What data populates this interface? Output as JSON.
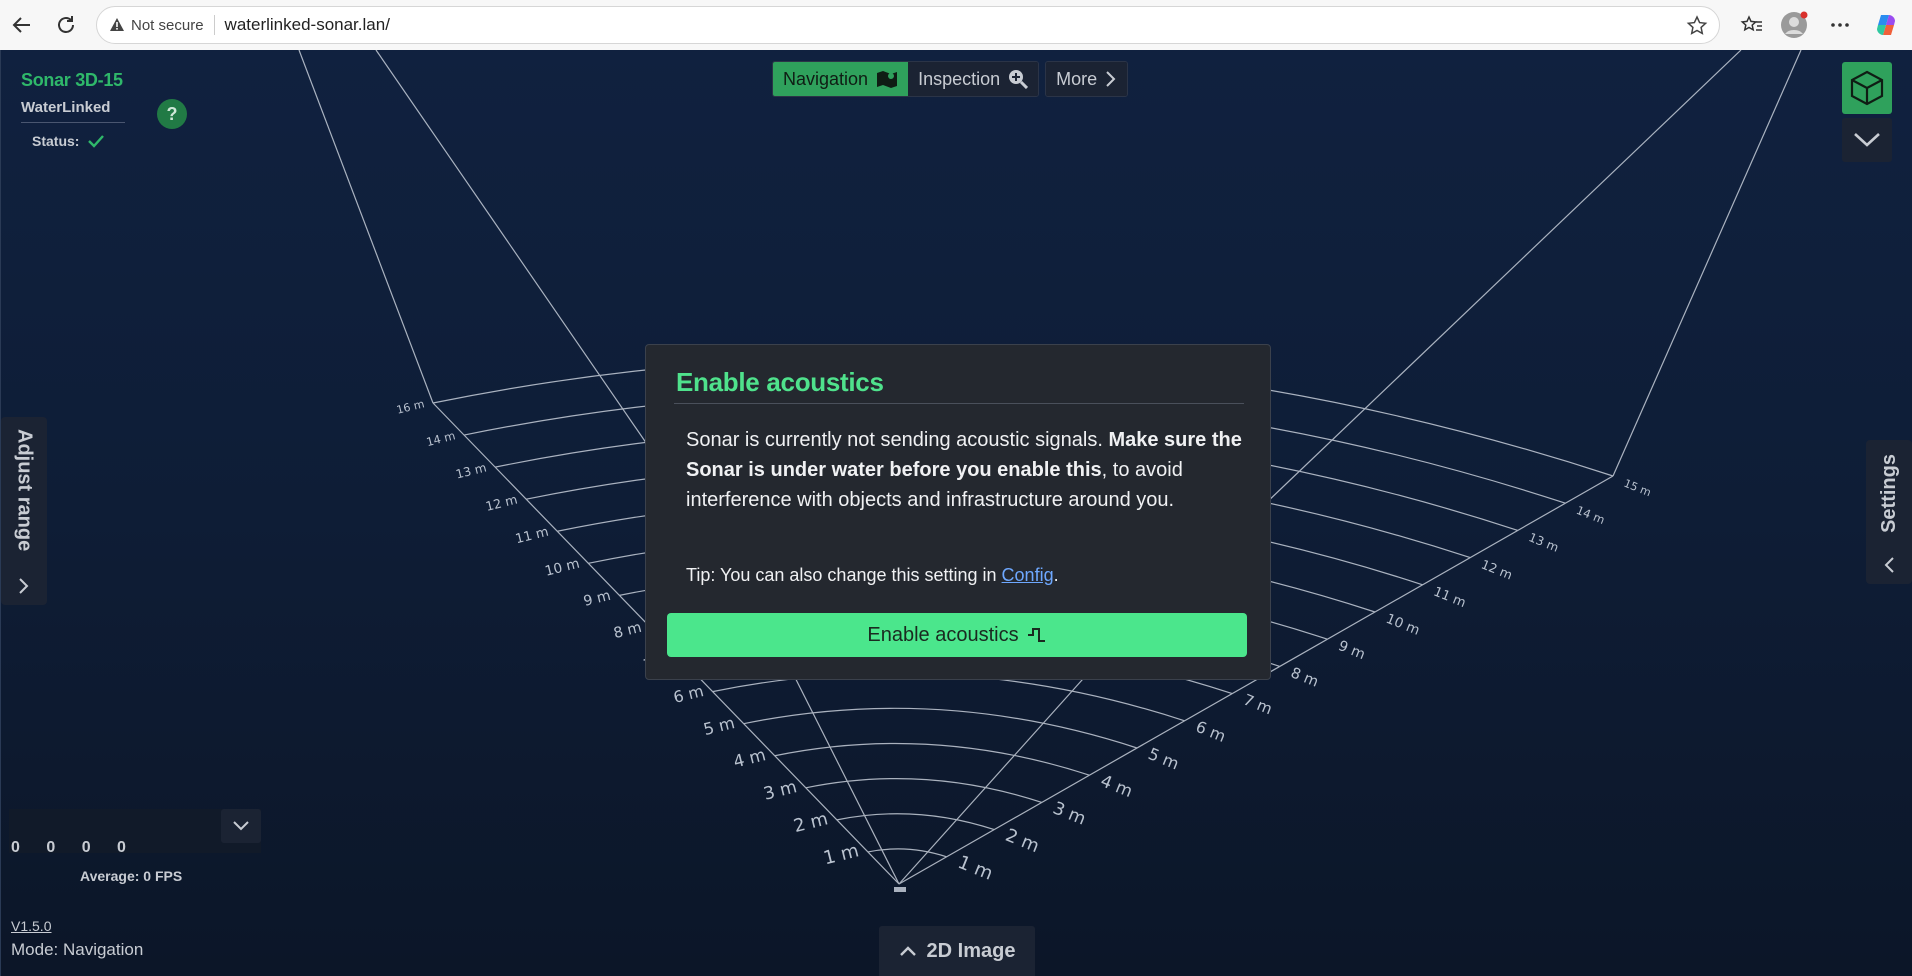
{
  "browser": {
    "security_label": "Not secure",
    "url": "waterlinked-sonar.lan/"
  },
  "brand": {
    "product": "Sonar 3D-15",
    "company": "WaterLinked",
    "status_label": "Status:"
  },
  "help": {
    "label": "?"
  },
  "topnav": {
    "tabs": [
      {
        "label": "Navigation",
        "icon": "map-icon",
        "active": true
      },
      {
        "label": "Inspection",
        "icon": "zoom-in-icon",
        "active": false
      },
      {
        "label": "More",
        "icon": "chevron-right-icon",
        "active": false
      }
    ]
  },
  "side": {
    "left_label": "Adjust range",
    "right_label": "Settings"
  },
  "scene": {
    "left_ticks": [
      "16 m",
      "14 m",
      "13 m",
      "12 m",
      "11 m",
      "10 m",
      "9 m",
      "8 m",
      "7 m",
      "6 m",
      "5 m",
      "4 m",
      "3 m",
      "2 m",
      "1 m"
    ],
    "right_ticks": [
      "15 m",
      "14 m",
      "13 m",
      "12 m",
      "11 m",
      "10 m",
      "9 m",
      "8 m",
      "7 m",
      "6 m",
      "5 m",
      "4 m",
      "3 m",
      "2 m",
      "1 m"
    ]
  },
  "fps": {
    "digits": "0 0 0 0",
    "average": "Average: 0 FPS"
  },
  "footer": {
    "version": "V1.5.0",
    "mode": "Mode: Navigation",
    "image_button": "2D Image"
  },
  "modal": {
    "title": "Enable acoustics",
    "body_plain_1": "Sonar is currently not sending acoustic signals. ",
    "body_bold": "Make sure the Sonar is under water before you enable this",
    "body_plain_2": ", to avoid interference with objects and infrastructure around you.",
    "tip_prefix": "Tip: You can also change this setting in ",
    "tip_link": "Config",
    "tip_suffix": ".",
    "button_label": "Enable acoustics"
  },
  "colors": {
    "accent_green": "#4be68c",
    "nav_active": "#2fa15c",
    "link": "#6ea8ff"
  }
}
